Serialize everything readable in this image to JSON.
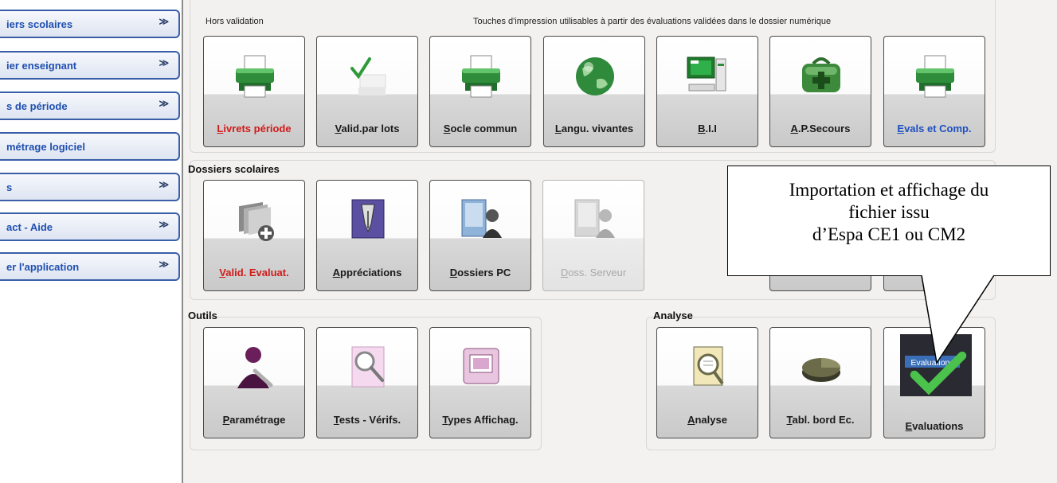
{
  "sidebar": {
    "items": [
      {
        "label": "iers scolaires",
        "chevron": "≫"
      },
      {
        "label": "ier enseignant",
        "chevron": "≫"
      },
      {
        "label": "s de période",
        "chevron": "≫"
      },
      {
        "label": "métrage logiciel",
        "chevron": ""
      },
      {
        "label": "s",
        "chevron": "≫"
      },
      {
        "label": "act - Aide",
        "chevron": "≫"
      },
      {
        "label": "er l'application",
        "chevron": "≫"
      }
    ]
  },
  "impressions": {
    "subtitle_left": "Hors validation",
    "subtitle_right": "Touches d'impression utilisables à partir des évaluations validées dans le dossier numérique",
    "tiles": [
      {
        "acc": "L",
        "rest": "ivrets période",
        "icon": "printer-icon"
      },
      {
        "acc": "V",
        "rest": "alid.par lots",
        "icon": "checkmark-icon"
      },
      {
        "acc": "S",
        "rest": "ocle commun",
        "icon": "printer-icon"
      },
      {
        "acc": "L",
        "rest": "angu. vivantes",
        "icon": "globe-icon"
      },
      {
        "acc": "B",
        "rest": ".I.I",
        "icon": "computer-icon"
      },
      {
        "acc": "A",
        "rest": ".P.Secours",
        "icon": "first-aid-bag-icon"
      },
      {
        "acc": "E",
        "rest": "vals et Comp.",
        "icon": "printer-icon"
      }
    ]
  },
  "dossiers": {
    "title": "Dossiers scolaires",
    "tiles": [
      {
        "acc": "V",
        "rest": "alid. Evaluat.",
        "icon": "folders-add-icon"
      },
      {
        "acc": "A",
        "rest": "ppréciations",
        "icon": "pen-nib-icon"
      },
      {
        "acc": "D",
        "rest": "ossiers PC",
        "icon": "folder-user-icon"
      },
      {
        "acc": "D",
        "rest": "oss. Serveur",
        "icon": "folder-user-icon"
      }
    ]
  },
  "outils": {
    "title": "Outils",
    "tiles": [
      {
        "acc": "P",
        "rest": "aramétrage",
        "icon": "user-settings-icon"
      },
      {
        "acc": "T",
        "rest": "ests - Vérifs.",
        "icon": "magnifier-icon"
      },
      {
        "acc": "T",
        "rest": "ypes Affichag.",
        "icon": "display-icon"
      }
    ]
  },
  "analyse": {
    "title": "Analyse",
    "tiles": [
      {
        "acc": "A",
        "rest": "nalyse",
        "icon": "document-magnifier-icon"
      },
      {
        "acc": "T",
        "rest": "abl. bord Ec.",
        "icon": "pie-chart-icon"
      },
      {
        "acc": "E",
        "rest": "valuations",
        "icon": "evaluations-icon",
        "badge": "Evaluations"
      }
    ]
  },
  "callout": {
    "lines": [
      "Importation et affichage du",
      "fichier issu",
      "d’Espa CE1 ou CM2"
    ]
  }
}
